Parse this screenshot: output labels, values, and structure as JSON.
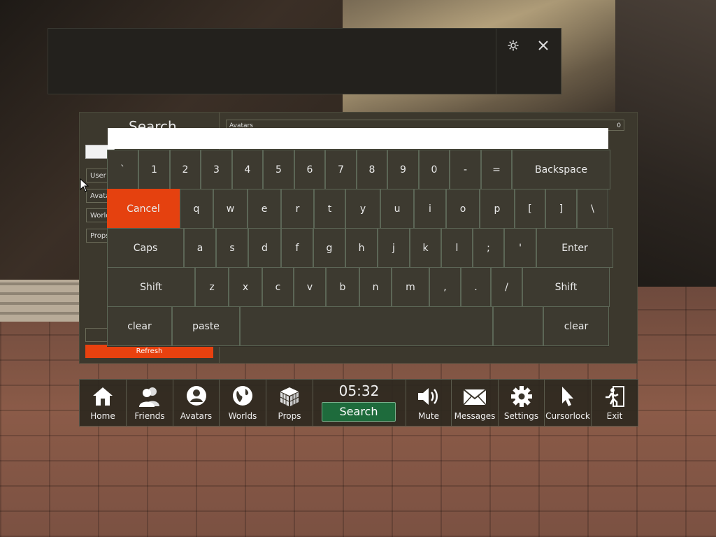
{
  "top_panel": {
    "settings_icon": "gear-icon",
    "close_icon": "close-icon"
  },
  "search_panel": {
    "title": "Search",
    "filters": [
      "User",
      "Avatars",
      "Worlds",
      "Props"
    ],
    "refresh_label": "Refresh",
    "results_header": {
      "label": "Avatars",
      "count": "0"
    }
  },
  "keyboard": {
    "rows": [
      [
        "`",
        "1",
        "2",
        "3",
        "4",
        "5",
        "6",
        "7",
        "8",
        "9",
        "0",
        "-",
        "=",
        "Backspace"
      ],
      [
        "Cancel",
        "q",
        "w",
        "e",
        "r",
        "t",
        "y",
        "u",
        "i",
        "o",
        "p",
        "[",
        "]",
        "\\"
      ],
      [
        "Caps",
        "a",
        "s",
        "d",
        "f",
        "g",
        "h",
        "j",
        "k",
        "l",
        ";",
        "'",
        "Enter"
      ],
      [
        "Shift",
        "z",
        "x",
        "c",
        "v",
        "b",
        "n",
        "m",
        ",",
        ".",
        "/",
        "Shift"
      ],
      [
        "clear",
        "paste",
        "",
        "",
        "clear"
      ]
    ]
  },
  "bottom_bar": {
    "tabs_left": [
      {
        "label": "Home",
        "icon": "home-icon"
      },
      {
        "label": "Friends",
        "icon": "friends-icon"
      },
      {
        "label": "Avatars",
        "icon": "avatar-icon"
      },
      {
        "label": "Worlds",
        "icon": "globe-icon"
      },
      {
        "label": "Props",
        "icon": "cube-icon"
      }
    ],
    "time": "05:32",
    "search_label": "Search",
    "tabs_right": [
      {
        "label": "Mute",
        "icon": "speaker-icon"
      },
      {
        "label": "Messages",
        "icon": "envelope-icon"
      },
      {
        "label": "Settings",
        "icon": "gear-icon"
      },
      {
        "label": "Cursorlock",
        "icon": "cursor-icon"
      },
      {
        "label": "Exit",
        "icon": "exit-icon"
      }
    ]
  }
}
